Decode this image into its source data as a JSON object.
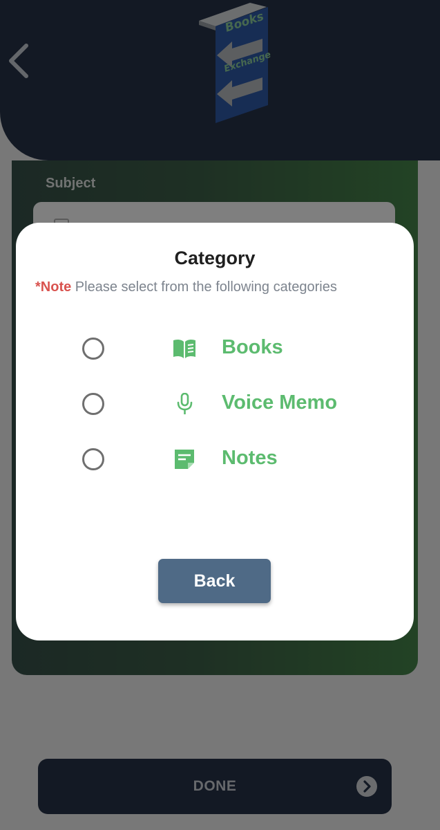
{
  "form": {
    "subject_label": "Subject"
  },
  "footer": {
    "done_label": "DONE"
  },
  "modal": {
    "title": "Category",
    "note_prefix": "*Note",
    "note_text": " Please select from the following categories",
    "options": [
      {
        "label": "Books",
        "icon": "book-icon",
        "selected": false
      },
      {
        "label": "Voice Memo",
        "icon": "microphone-icon",
        "selected": false
      },
      {
        "label": "Notes",
        "icon": "note-icon",
        "selected": false
      }
    ],
    "back_label": "Back"
  },
  "logo": {
    "line1": "Books",
    "line2": "Exchange"
  },
  "colors": {
    "header": "#263248",
    "accent_green": "#5cbb6f",
    "note_red": "#d9534f",
    "back_button": "#4f6a86"
  }
}
